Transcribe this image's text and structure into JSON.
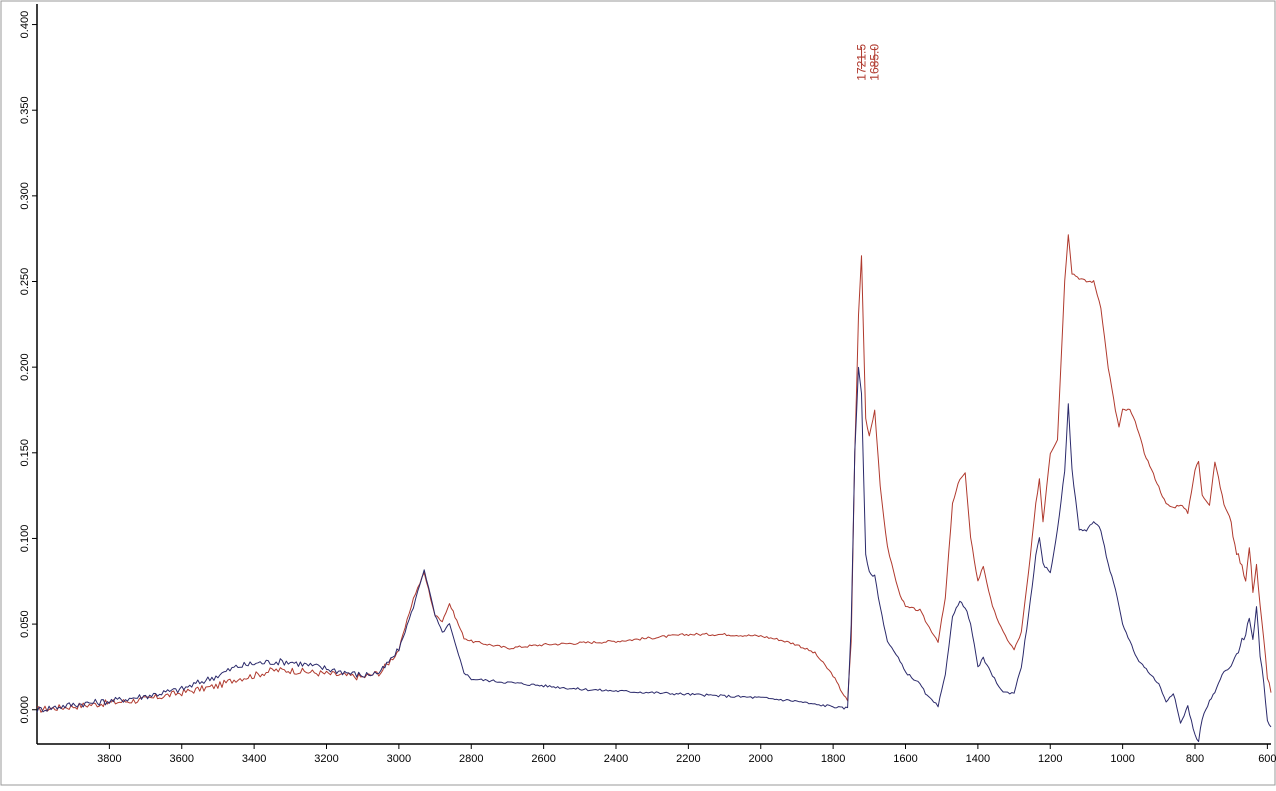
{
  "chart_data": {
    "type": "line",
    "title": "",
    "xlabel": "",
    "ylabel": "",
    "x_reversed": true,
    "xlim": [
      4000,
      590
    ],
    "ylim": [
      -0.02,
      0.412
    ],
    "x_ticks": [
      "3800",
      "3600",
      "3400",
      "3200",
      "3000",
      "2800",
      "2600",
      "2400",
      "2200",
      "2000",
      "1800",
      "1600",
      "1400",
      "1200",
      "1000",
      "800",
      "600"
    ],
    "y_ticks": [
      "0.000",
      "0.050",
      "0.100",
      "0.150",
      "0.200",
      "0.250",
      "0.300",
      "0.350",
      "0.400"
    ],
    "grid": false,
    "legend": "none",
    "peak_labels": [
      {
        "x": 1721.5,
        "label": "1721.5"
      },
      {
        "x": 1685.0,
        "label": "1685.0"
      }
    ],
    "series": [
      {
        "color": "#b03a2e",
        "x": [
          4000,
          3900,
          3800,
          3700,
          3600,
          3500,
          3450,
          3400,
          3350,
          3300,
          3250,
          3200,
          3150,
          3100,
          3050,
          3000,
          2960,
          2930,
          2900,
          2880,
          2860,
          2840,
          2820,
          2800,
          2700,
          2600,
          2500,
          2400,
          2300,
          2200,
          2100,
          2000,
          1950,
          1900,
          1850,
          1800,
          1780,
          1760,
          1750,
          1740,
          1730,
          1721.5,
          1710,
          1700,
          1685,
          1670,
          1650,
          1620,
          1600,
          1560,
          1540,
          1510,
          1490,
          1470,
          1450,
          1435,
          1420,
          1400,
          1385,
          1360,
          1330,
          1300,
          1280,
          1260,
          1240,
          1230,
          1220,
          1200,
          1180,
          1160,
          1150,
          1140,
          1120,
          1100,
          1080,
          1060,
          1040,
          1020,
          1010,
          1000,
          980,
          960,
          940,
          920,
          900,
          880,
          860,
          840,
          820,
          800,
          790,
          780,
          760,
          745,
          730,
          720,
          700,
          690,
          680,
          670,
          660,
          650,
          640,
          630,
          620,
          610,
          600,
          590
        ],
        "y": [
          0.0,
          0.002,
          0.004,
          0.006,
          0.01,
          0.014,
          0.018,
          0.02,
          0.023,
          0.023,
          0.022,
          0.021,
          0.02,
          0.019,
          0.022,
          0.035,
          0.065,
          0.08,
          0.055,
          0.052,
          0.062,
          0.052,
          0.042,
          0.04,
          0.036,
          0.038,
          0.039,
          0.04,
          0.042,
          0.044,
          0.044,
          0.043,
          0.041,
          0.038,
          0.033,
          0.02,
          0.012,
          0.005,
          0.04,
          0.15,
          0.23,
          0.265,
          0.17,
          0.16,
          0.175,
          0.13,
          0.095,
          0.07,
          0.06,
          0.058,
          0.05,
          0.04,
          0.065,
          0.12,
          0.135,
          0.138,
          0.1,
          0.075,
          0.084,
          0.06,
          0.045,
          0.035,
          0.045,
          0.08,
          0.12,
          0.135,
          0.11,
          0.15,
          0.158,
          0.25,
          0.278,
          0.255,
          0.252,
          0.25,
          0.25,
          0.235,
          0.2,
          0.175,
          0.165,
          0.175,
          0.175,
          0.165,
          0.15,
          0.14,
          0.13,
          0.12,
          0.118,
          0.12,
          0.115,
          0.14,
          0.145,
          0.125,
          0.12,
          0.145,
          0.13,
          0.12,
          0.11,
          0.095,
          0.09,
          0.085,
          0.075,
          0.095,
          0.07,
          0.085,
          0.06,
          0.04,
          0.02,
          0.01
        ]
      },
      {
        "color": "#2b2a6b",
        "x": [
          4000,
          3900,
          3800,
          3700,
          3600,
          3500,
          3450,
          3400,
          3350,
          3300,
          3250,
          3200,
          3150,
          3100,
          3050,
          3000,
          2960,
          2930,
          2900,
          2880,
          2860,
          2840,
          2820,
          2800,
          2700,
          2600,
          2500,
          2400,
          2300,
          2200,
          2100,
          2000,
          1950,
          1900,
          1850,
          1800,
          1780,
          1760,
          1750,
          1740,
          1730,
          1721.5,
          1710,
          1700,
          1685,
          1670,
          1650,
          1620,
          1600,
          1560,
          1540,
          1510,
          1490,
          1470,
          1450,
          1435,
          1420,
          1400,
          1385,
          1360,
          1330,
          1300,
          1280,
          1260,
          1240,
          1230,
          1220,
          1200,
          1180,
          1160,
          1150,
          1140,
          1120,
          1100,
          1080,
          1060,
          1040,
          1020,
          1010,
          1000,
          980,
          960,
          940,
          920,
          900,
          880,
          860,
          840,
          820,
          800,
          790,
          780,
          760,
          745,
          730,
          720,
          700,
          690,
          680,
          670,
          660,
          650,
          640,
          630,
          620,
          610,
          600,
          590
        ],
        "y": [
          0.0,
          0.003,
          0.005,
          0.008,
          0.012,
          0.02,
          0.025,
          0.027,
          0.028,
          0.028,
          0.026,
          0.024,
          0.022,
          0.02,
          0.022,
          0.035,
          0.06,
          0.082,
          0.055,
          0.045,
          0.05,
          0.035,
          0.022,
          0.018,
          0.016,
          0.014,
          0.012,
          0.011,
          0.01,
          0.009,
          0.008,
          0.007,
          0.006,
          0.005,
          0.003,
          0.002,
          0.001,
          0.001,
          0.05,
          0.15,
          0.2,
          0.185,
          0.09,
          0.08,
          0.078,
          0.06,
          0.04,
          0.03,
          0.022,
          0.015,
          0.008,
          0.002,
          0.02,
          0.055,
          0.063,
          0.06,
          0.05,
          0.025,
          0.03,
          0.02,
          0.01,
          0.01,
          0.025,
          0.055,
          0.09,
          0.1,
          0.085,
          0.08,
          0.105,
          0.14,
          0.178,
          0.14,
          0.105,
          0.105,
          0.11,
          0.105,
          0.085,
          0.07,
          0.06,
          0.05,
          0.04,
          0.03,
          0.025,
          0.02,
          0.015,
          0.005,
          0.01,
          -0.008,
          0.002,
          -0.015,
          -0.018,
          -0.005,
          0.005,
          0.01,
          0.018,
          0.022,
          0.025,
          0.03,
          0.035,
          0.04,
          0.045,
          0.055,
          0.04,
          0.06,
          0.03,
          0.015,
          -0.005,
          -0.01
        ]
      }
    ]
  }
}
